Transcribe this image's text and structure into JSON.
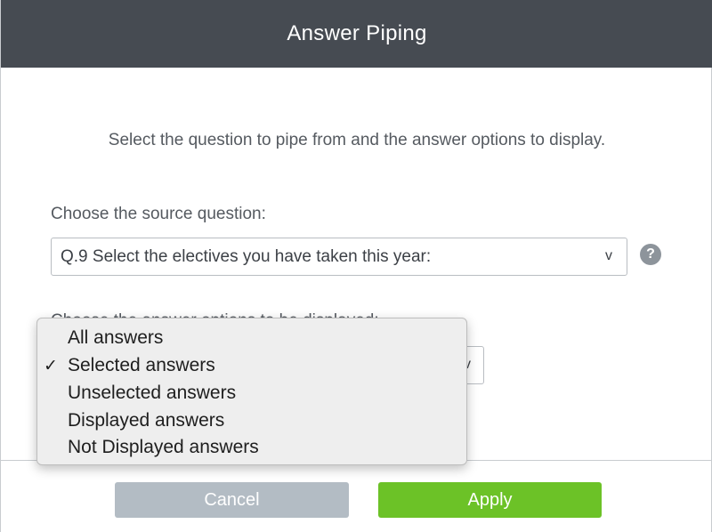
{
  "dialog": {
    "title": "Answer Piping",
    "instructions": "Select the question to pipe from and the answer options to display."
  },
  "source": {
    "label": "Choose the source question:",
    "selected": "Q.9 Select the electives you have taken this year:",
    "chevron": "v",
    "help_icon": "?"
  },
  "display": {
    "label": "Choose the answer options to be displayed:",
    "chevron": "v"
  },
  "dropdown": {
    "checkmark": "✓",
    "selected_index": 1,
    "options": [
      "All answers",
      "Selected answers",
      "Unselected answers",
      "Displayed answers",
      "Not Displayed answers"
    ]
  },
  "footer": {
    "cancel_label": "Cancel",
    "apply_label": "Apply"
  },
  "colors": {
    "header_bg": "#464b52",
    "cancel_bg": "#b3bcc4",
    "apply_bg": "#6cc227"
  }
}
